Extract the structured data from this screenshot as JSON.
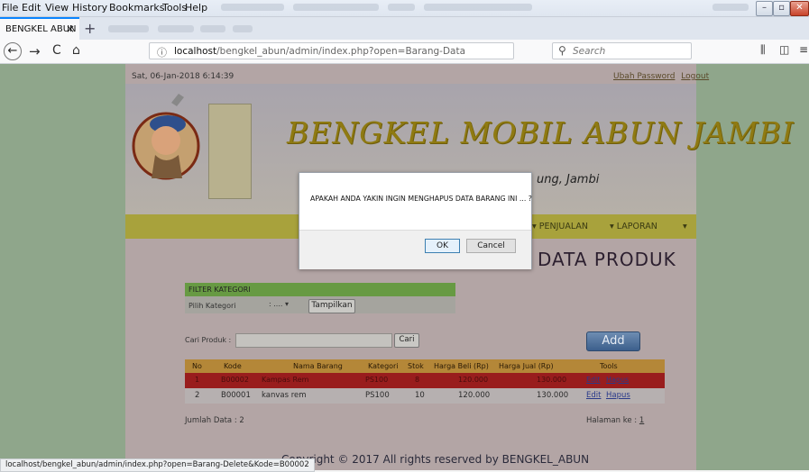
{
  "browser": {
    "menu": [
      "File",
      "Edit",
      "View",
      "History",
      "Bookmarks",
      "Tools",
      "Help"
    ],
    "tab_title": "BENGKEL ABUN",
    "url_host": "localhost",
    "url_path": "/bengkel_abun/admin/index.php?open=Barang-Data",
    "search_placeholder": "Search",
    "status_url": "localhost/bengkel_abun/admin/index.php?open=Barang-Delete&Kode=B00002"
  },
  "site": {
    "datetime": "Sat, 06-Jan-2018 6:14:39",
    "ubah_password": "Ubah Password",
    "logout": "Logout",
    "brand": "BENGKEL MOBIL ABUN JAMBI",
    "tagline_partial": "ung, Jambi",
    "nav": [
      "PENJUALAN",
      "LAPORAN"
    ],
    "page_title": "DATA PRODUK"
  },
  "filter": {
    "title": "FILTER KATEGORI",
    "label": "Pilih Kategori",
    "selected": "....",
    "button": "Tampilkan"
  },
  "search": {
    "label": "Cari Produk :",
    "button": "Cari",
    "add_button": "Add"
  },
  "table": {
    "headers": [
      "No",
      "Kode",
      "Nama Barang",
      "Kategori",
      "Stok",
      "Harga Beli (Rp)",
      "Harga Jual (Rp)",
      "Tools"
    ],
    "rows": [
      {
        "no": "1",
        "kode": "B00002",
        "nama": "Kampas Rem",
        "kategori": "PS100",
        "stok": "8",
        "beli": "120.000",
        "jual": "130.000",
        "edit": "Edit",
        "hapus": "Hapus"
      },
      {
        "no": "2",
        "kode": "B00001",
        "nama": "kanvas rem",
        "kategori": "PS100",
        "stok": "10",
        "beli": "120.000",
        "jual": "130.000",
        "edit": "Edit",
        "hapus": "Hapus"
      }
    ],
    "jumlah": "Jumlah Data : 2",
    "halaman_label": "Halaman ke :",
    "halaman_page": "1"
  },
  "footer": "Copyright © 2017 All rights reserved by BENGKEL_ABUN",
  "dialog": {
    "message": "APAKAH ANDA YAKIN INGIN MENGHAPUS DATA BARANG INI ... ?",
    "ok": "OK",
    "cancel": "Cancel"
  }
}
